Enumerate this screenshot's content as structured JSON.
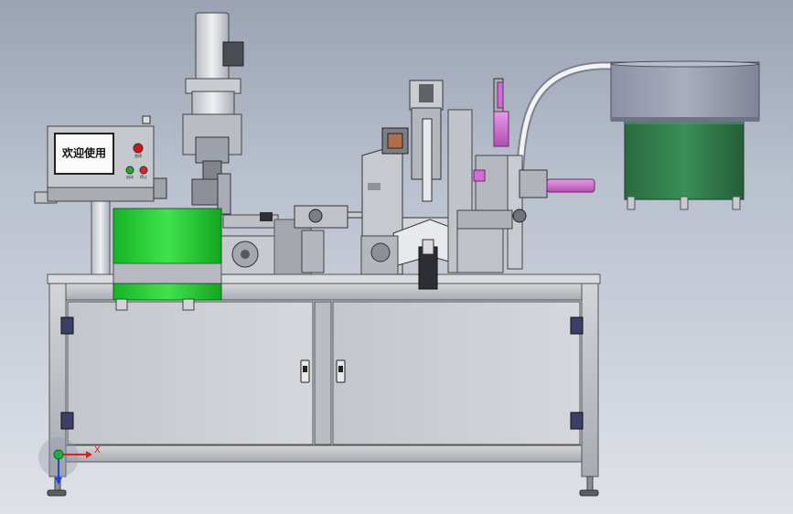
{
  "hmi": {
    "screen_text": "欢迎使用"
  },
  "panel": {
    "button_left_label": "启动",
    "button_right_label": "停止",
    "estop_label": "急停"
  },
  "triad": {
    "x_label": "X"
  },
  "colors": {
    "background_top": "#9aa2b4",
    "background_bottom": "#dfe2e8",
    "frame": "#b4b7bd",
    "cabinet_door": "#c9ccd1",
    "green_bowl": "#22cc33",
    "feeder_green": "#2f7a49",
    "magenta_cylinder": "#d26bd2",
    "emergency_red": "#dd1111"
  }
}
